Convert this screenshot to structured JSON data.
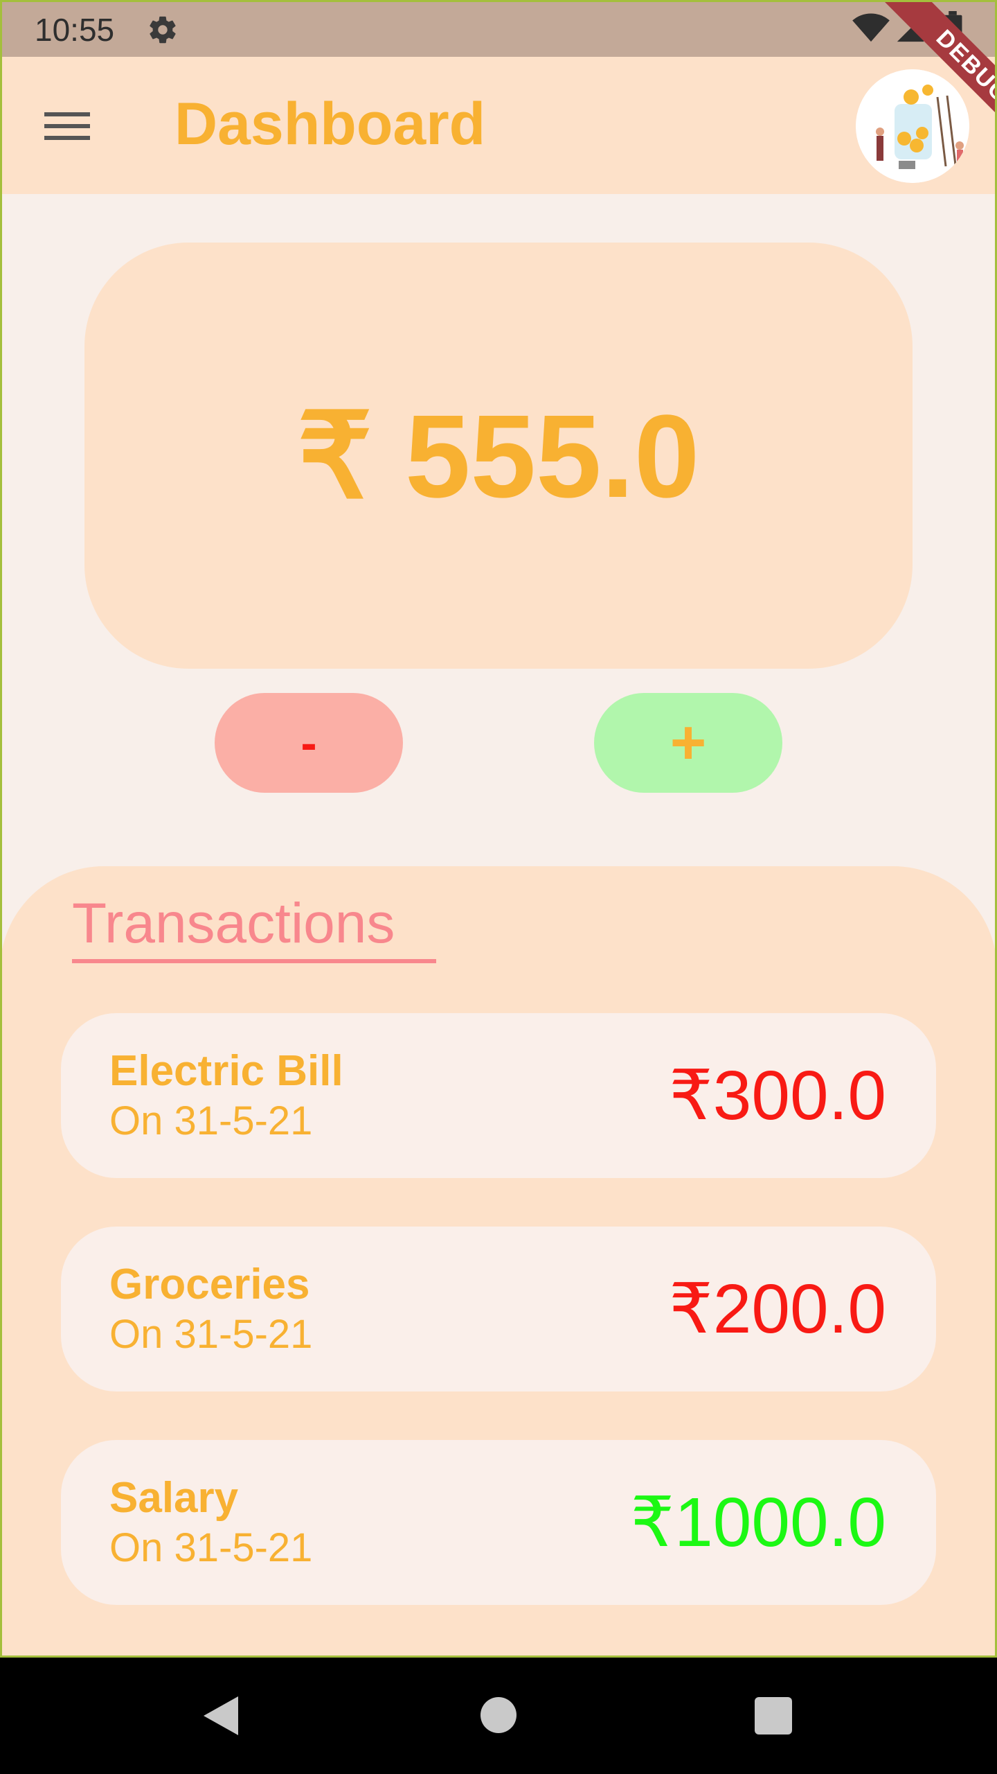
{
  "status_bar": {
    "time": "10:55",
    "icons": [
      "gear-icon",
      "wifi-icon",
      "signal-icon",
      "battery-icon"
    ]
  },
  "app_bar": {
    "title": "Dashboard",
    "menu_icon": "hamburger-menu-icon",
    "avatar": "savings-illustration-avatar",
    "debug_banner": "DEBUG"
  },
  "balance": {
    "amount": "₹ 555.0"
  },
  "actions": {
    "minus_label": "-",
    "plus_label": "+"
  },
  "transactions": {
    "heading": "Transactions",
    "items": [
      {
        "name": "Electric Bill",
        "date": "On 31-5-21",
        "amount": "₹300.0",
        "type": "debit"
      },
      {
        "name": "Groceries",
        "date": "On 31-5-21",
        "amount": "₹200.0",
        "type": "debit"
      },
      {
        "name": "Salary",
        "date": "On 31-5-21",
        "amount": "₹1000.0",
        "type": "credit"
      }
    ]
  },
  "colors": {
    "accent": "#F8B132",
    "debit": "#F81A14",
    "credit": "#1CF814",
    "card_bg": "#FDE1C9",
    "page_bg": "#F8EFEA",
    "heading_pink": "#F8878D"
  },
  "nav_bar": {
    "icons": [
      "back-icon",
      "home-icon",
      "recents-icon"
    ]
  }
}
